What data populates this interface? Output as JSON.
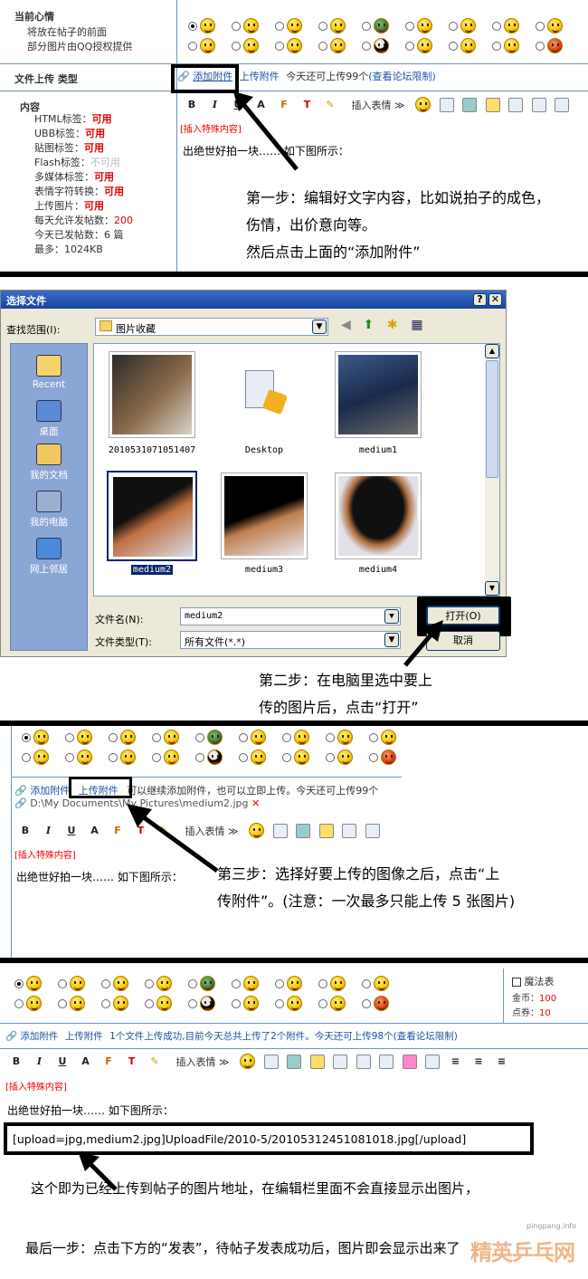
{
  "p1": {
    "mood_title": "当前心情",
    "mood_desc1": "将放在帖子的前面",
    "mood_desc2": "部分图片由QQ授权提供",
    "upload_label": "文件上传",
    "type_label": "类型",
    "add_attach": "添加附件",
    "upload_attach": "上传附件",
    "limit_text": "今天还可上传99个",
    "limit_link": "(查看论坛限制)",
    "content_label": "内容",
    "rules": [
      {
        "k": "HTML标签：",
        "v": "可用"
      },
      {
        "k": "UBB标签：",
        "v": "可用"
      },
      {
        "k": "贴图标签：",
        "v": "可用"
      },
      {
        "k": "Flash标签：",
        "v": "不可用"
      },
      {
        "k": "多媒体标签：",
        "v": "可用"
      },
      {
        "k": "表情字符转换：",
        "v": "可用"
      },
      {
        "k": "上传图片：",
        "v": "可用"
      },
      {
        "k": "每天允许发帖数：",
        "v": "200"
      },
      {
        "k": "今天已发帖数：",
        "v": "6 篇"
      },
      {
        "k": "最多：",
        "v": "1024KB"
      }
    ],
    "insert_emote": "插入表情 ≫",
    "special": "[插入特殊内容]",
    "body_text": "出绝世好拍一块…… 如下图所示：",
    "step1_line1": "第一步：编辑好文字内容，比如说拍子的成色，",
    "step1_line2": "伤情，出价意向等。",
    "step1_line3": "然后点击上面的“添加附件”"
  },
  "p2": {
    "title": "选择文件",
    "lookin_label": "查找范围(I):",
    "lookin_value": "图片收藏",
    "places": [
      "Recent",
      "桌面",
      "我的文档",
      "我的电脑",
      "网上邻居"
    ],
    "files": [
      "2010531071051407",
      "Desktop",
      "medium1",
      "medium2",
      "medium3",
      "medium4"
    ],
    "filename_label": "文件名(N):",
    "filename_value": "medium2",
    "filetype_label": "文件类型(T):",
    "filetype_value": "所有文件(*.*)",
    "open_btn": "打开(O)",
    "cancel_btn": "取消",
    "step2_line1": "第二步：在电脑里选中要上",
    "step2_line2": "传的图片后，点击“打开”"
  },
  "p3": {
    "add_attach": "添加附件",
    "upload_attach": "上传附件",
    "note": "可以继续添加附件，也可以立即上传。今天还可上传99个",
    "path": "D:\\My Documents\\My Pictures\\medium2.jpg",
    "insert_emote": "插入表情 ≫",
    "special": "[插入特殊内容]",
    "body_text": "出绝世好拍一块…… 如下图所示：",
    "step3_line1": "第三步：选择好要上传的图像之后，点击“上",
    "step3_line2": "传附件”。(注意：一次最多只能上传 5 张图片)"
  },
  "p4": {
    "magic": "魔法表",
    "coins_label": "金币：",
    "coins_value": "100",
    "points_label": "点券：",
    "points_value": "10",
    "add_attach": "添加附件",
    "upload_attach": "上传附件",
    "status": "1个文件上传成功,目前今天总共上传了2个附件。今天还可上传98个",
    "limit_link": "(查看论坛限制)",
    "insert_emote": "插入表情 ≫",
    "special": "[插入特殊内容]",
    "body_text": "出绝世好拍一块…… 如下图所示：",
    "upload_code": "[upload=jpg,medium2.jpg]UploadFile/2010-5/20105312451081018.jpg[/upload]",
    "note1": "这个即为已经上传到帖子的图片地址，在编辑栏里面不会直接显示出图片，",
    "note2": "最后一步：点击下方的“发表”，待帖子发表成功后，图片即会显示出来了",
    "watermark_url": "pingpang.info",
    "watermark_logo": "精英乒乓网"
  },
  "colors": {
    "link": "#1a53a3",
    "ok": "#e00000",
    "border": "#6d94c2"
  }
}
